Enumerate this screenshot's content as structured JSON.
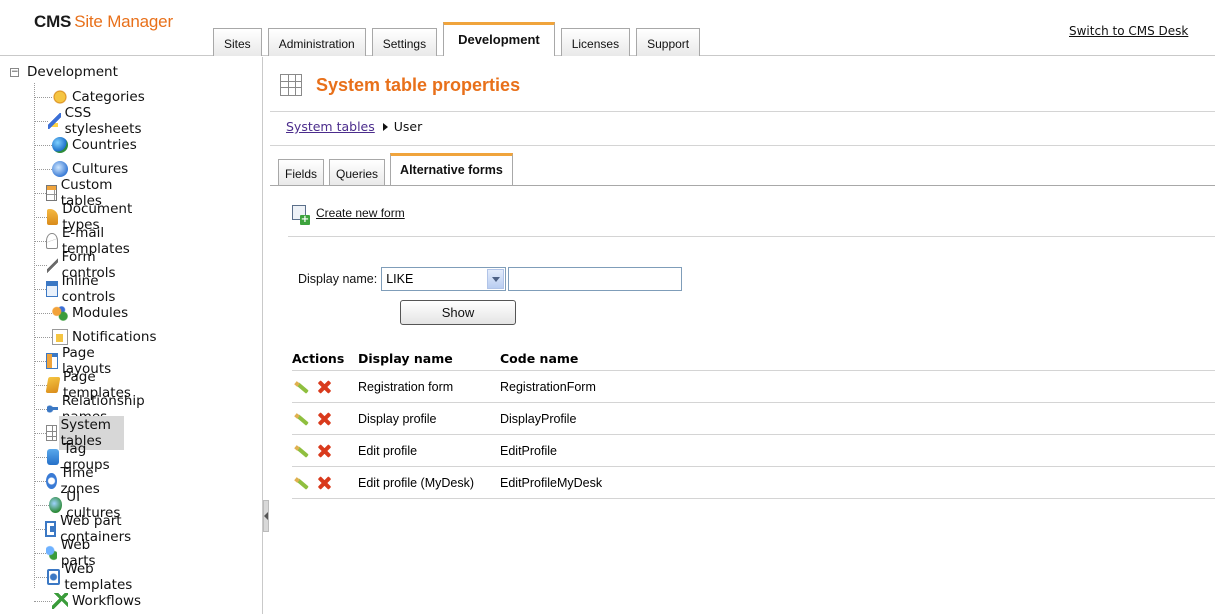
{
  "app": {
    "logo_cms": "CMS",
    "logo_site_manager": "Site Manager",
    "switch_link": "Switch to CMS Desk"
  },
  "top_tabs": [
    {
      "label": "Sites"
    },
    {
      "label": "Administration"
    },
    {
      "label": "Settings"
    },
    {
      "label": "Development",
      "active": true
    },
    {
      "label": "Licenses"
    },
    {
      "label": "Support"
    }
  ],
  "sidebar": {
    "root_label": "Development",
    "items": [
      {
        "label": "Categories",
        "icon": "categories-icon"
      },
      {
        "label": "CSS stylesheets",
        "icon": "css-stylesheet-icon"
      },
      {
        "label": "Countries",
        "icon": "countries-globe-icon"
      },
      {
        "label": "Cultures",
        "icon": "cultures-globe-icon"
      },
      {
        "label": "Custom tables",
        "icon": "custom-table-icon"
      },
      {
        "label": "Document types",
        "icon": "document-type-icon"
      },
      {
        "label": "E-mail templates",
        "icon": "email-icon"
      },
      {
        "label": "Form controls",
        "icon": "form-control-icon"
      },
      {
        "label": "Inline controls",
        "icon": "inline-control-icon"
      },
      {
        "label": "Modules",
        "icon": "modules-icon"
      },
      {
        "label": "Notifications",
        "icon": "notification-icon"
      },
      {
        "label": "Page layouts",
        "icon": "page-layout-icon"
      },
      {
        "label": "Page templates",
        "icon": "page-template-icon"
      },
      {
        "label": "Relationship names",
        "icon": "relationship-icon"
      },
      {
        "label": "System tables",
        "icon": "system-table-icon",
        "selected": true
      },
      {
        "label": "Tag groups",
        "icon": "tag-group-icon"
      },
      {
        "label": "Time zones",
        "icon": "time-zone-icon"
      },
      {
        "label": "UI cultures",
        "icon": "ui-culture-icon"
      },
      {
        "label": "Web part containers",
        "icon": "web-part-container-icon"
      },
      {
        "label": "Web parts",
        "icon": "web-parts-icon"
      },
      {
        "label": "Web templates",
        "icon": "web-template-icon"
      },
      {
        "label": "Workflows",
        "icon": "workflow-icon"
      }
    ]
  },
  "main": {
    "title": "System table properties",
    "breadcrumb": {
      "link": "System tables",
      "current": "User"
    },
    "subtabs": [
      {
        "label": "Fields"
      },
      {
        "label": "Queries"
      },
      {
        "label": "Alternative forms",
        "active": true
      }
    ],
    "create_new_form": "Create new form",
    "filter": {
      "label": "Display name:",
      "operator": "LIKE",
      "value": "",
      "show_button": "Show"
    },
    "grid": {
      "headers": {
        "actions": "Actions",
        "display_name": "Display name",
        "code_name": "Code name"
      },
      "rows": [
        {
          "display_name": "Registration form",
          "code_name": "RegistrationForm"
        },
        {
          "display_name": "Display profile",
          "code_name": "DisplayProfile"
        },
        {
          "display_name": "Edit profile",
          "code_name": "EditProfile"
        },
        {
          "display_name": "Edit profile (MyDesk)",
          "code_name": "EditProfileMyDesk"
        }
      ]
    }
  },
  "colors": {
    "accent_orange": "#e8701a",
    "tab_highlight": "#f0a43c",
    "link_purple": "#4b2c8c",
    "delete_red": "#d93a1c",
    "edit_green": "#8fbf3f"
  }
}
